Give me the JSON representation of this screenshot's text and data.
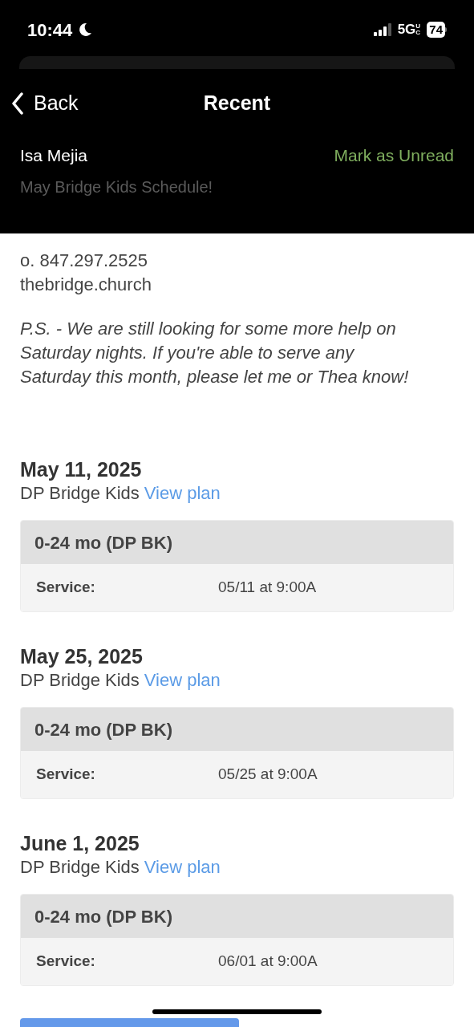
{
  "status_bar": {
    "time": "10:44",
    "network": "5G",
    "network_suffix": "UC",
    "battery": "74"
  },
  "nav": {
    "back": "Back",
    "title": "Recent"
  },
  "message": {
    "sender": "Isa Mejia",
    "action": "Mark as Unread",
    "subject": "May Bridge Kids Schedule!"
  },
  "body": {
    "contact_lines": [
      "o. 847.297.2525",
      "thebridge.church"
    ],
    "postscript": "P.S. - We are still looking for some more help on Saturday nights. If you're able to serve any Saturday this month, please let me or Thea know!"
  },
  "schedule": [
    {
      "date": "May 11, 2025",
      "team": "DP Bridge Kids",
      "link": "View plan",
      "position": "0-24 mo (DP BK)",
      "label": "Service:",
      "time": "05/11 at 9:00A"
    },
    {
      "date": "May 25, 2025",
      "team": "DP Bridge Kids",
      "link": "View plan",
      "position": "0-24 mo (DP BK)",
      "label": "Service:",
      "time": "05/25 at 9:00A"
    },
    {
      "date": "June 1, 2025",
      "team": "DP Bridge Kids",
      "link": "View plan",
      "position": "0-24 mo (DP BK)",
      "label": "Service:",
      "time": "06/01 at 9:00A"
    }
  ]
}
